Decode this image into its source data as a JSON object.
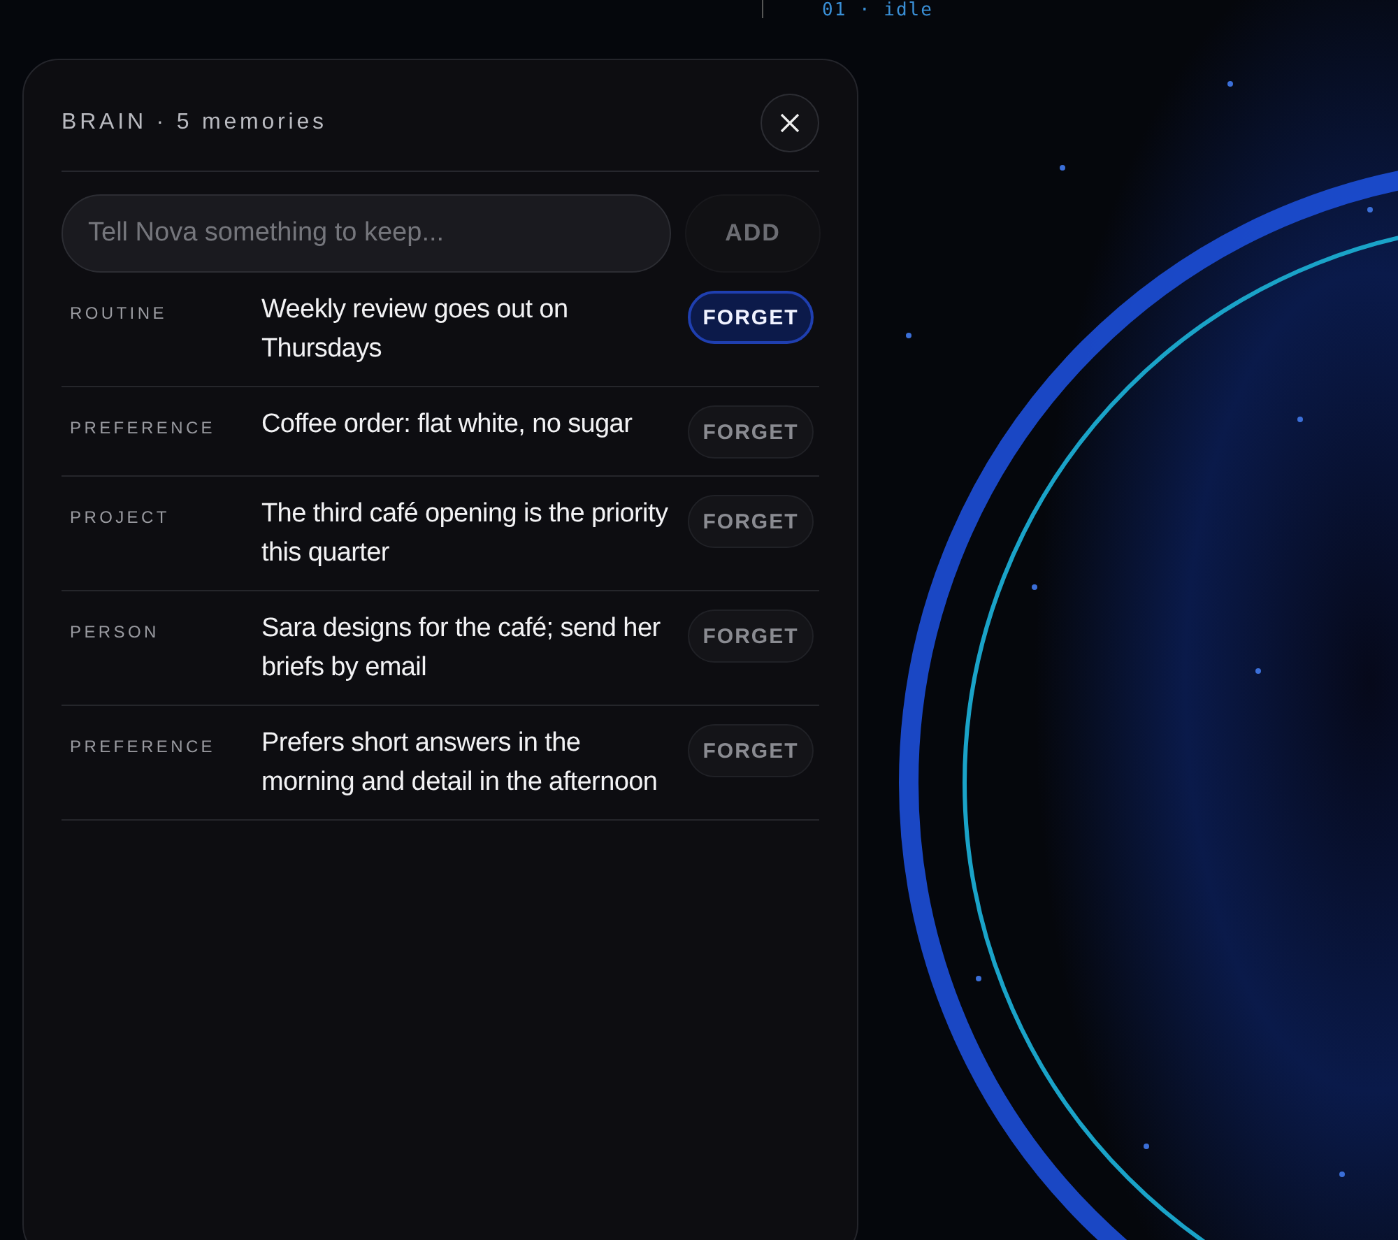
{
  "top_bar": {
    "status": "01 · idle"
  },
  "panel": {
    "title": "BRAIN · 5 memories",
    "input": {
      "placeholder": "Tell Nova something to keep..."
    },
    "add_button": "ADD",
    "memories": [
      {
        "category": "ROUTINE",
        "text": "Weekly review goes out on Thursdays",
        "button": "FORGET",
        "highlighted": true
      },
      {
        "category": "PREFERENCE",
        "text": "Coffee order: flat white, no sugar",
        "button": "FORGET",
        "highlighted": false
      },
      {
        "category": "PROJECT",
        "text": "The third café opening is the priority this quarter",
        "button": "FORGET",
        "highlighted": false
      },
      {
        "category": "PERSON",
        "text": "Sara designs for the café; send her briefs by email",
        "button": "FORGET",
        "highlighted": false
      },
      {
        "category": "PREFERENCE",
        "text": "Prefers short answers in the morning and detail in the afternoon",
        "button": "FORGET",
        "highlighted": false
      }
    ]
  }
}
